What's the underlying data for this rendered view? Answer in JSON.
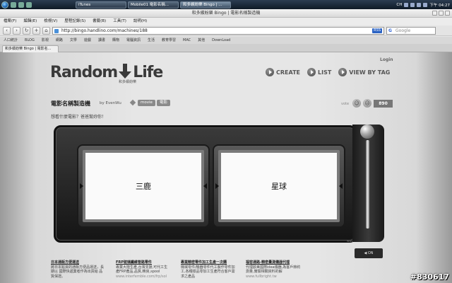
{
  "taskbar": {
    "tasks": [
      "iTunes",
      "Mobile01 電影名稱...",
      "和多繽紛樂 Bingo | ..."
    ],
    "tray": {
      "lang": "CH",
      "clock": "下午 04:27"
    }
  },
  "browser": {
    "window_title": "和多繽紛樂 Bingo | 電影名稱製造機",
    "menu": [
      "檔案(F)",
      "編輯(E)",
      "檢視(V)",
      "歷程記錄(S)",
      "書籤(B)",
      "工具(T)",
      "說明(H)"
    ],
    "address": "http://bingo.handlino.com/machines/188",
    "rss": "RSS",
    "search_placeholder": "Google",
    "bookmarks": [
      "人口統計",
      "BLOG",
      "影視",
      "網路",
      "文學",
      "遊戲",
      "讀書",
      "購物",
      "電腦資訊",
      "生活",
      "教育學習",
      "MAC",
      "其他",
      "DownLoad"
    ],
    "tab": "和多繽紛樂 Bingo | 電影名..."
  },
  "page": {
    "login": "Login",
    "logo_text": "Random",
    "logo_text2": "Life",
    "logo_sub": "和多繽紛樂",
    "nav": [
      "CREATE",
      "LIST",
      "VIEW BY TAG"
    ],
    "machine_title": "電影名稱製造機",
    "author": "by EvenWu",
    "tags": [
      "movie",
      "電影"
    ],
    "vote_label": "vote",
    "vote_count": "890",
    "question": "想看什麼電影？爸爸幫妳你！",
    "reels": [
      "三鹿",
      "星球"
    ],
    "machine_url": "www.xxx.com",
    "sound_label": "ON"
  },
  "ads": [
    {
      "title": "日本通販方便運送",
      "body": "將日本點資的通販方便品運送，長期以 國際快遞業者作為出貨給 品質保證。",
      "url": ""
    },
    {
      "title": "FRP玻璃纖維管路零件",
      "body": "專業大陸生產,台灣支援,可代工生產FRP產品,品質,精良,spool",
      "url": "www.interfemble.com/frp/sol"
    },
    {
      "title": "專業精密零件加工生產一次購",
      "body": "機械零件/機器零件代工製作零件加工,各種樣品零加工生產符合客戶需求之產品",
      "url": ""
    },
    {
      "title": "福容通路-精密量測儀器代理",
      "body": "代理歐美國際idea儀器,為客戶節約測量,實驗相關資料的解",
      "url": "www.fullbright.tw"
    }
  ],
  "watermark": "#830617"
}
